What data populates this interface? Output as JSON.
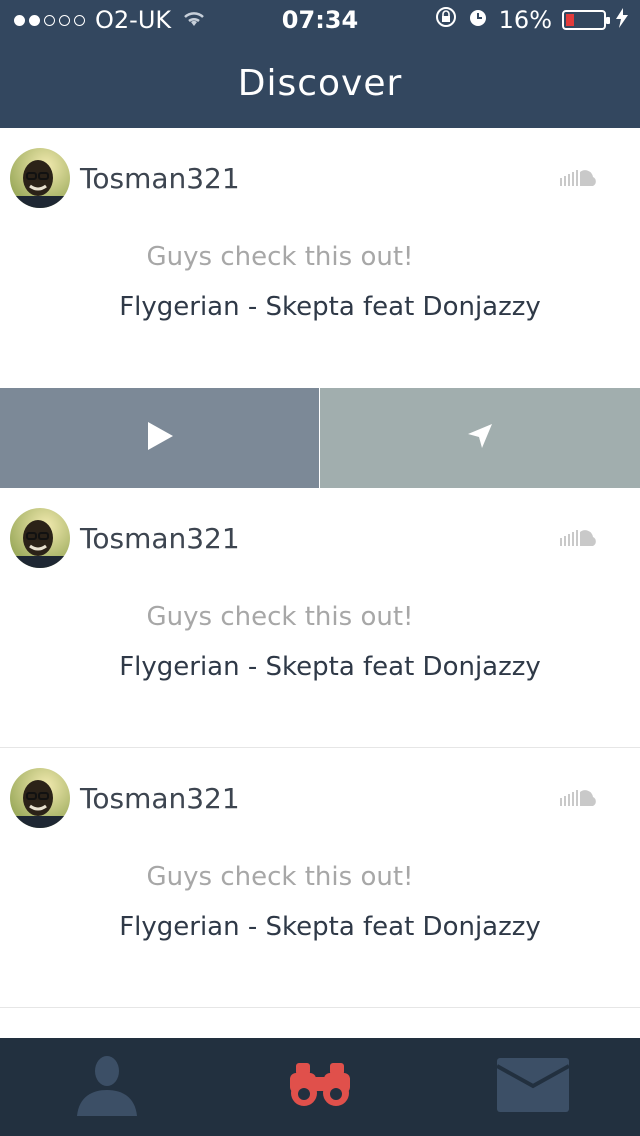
{
  "status": {
    "carrier": "O2-UK",
    "signal_dots_filled": 2,
    "signal_dots_total": 5,
    "time": "07:34",
    "battery_percent": "16%",
    "icons": [
      "wifi-icon",
      "orientation-lock-icon",
      "alarm-icon",
      "battery-icon",
      "charging-icon"
    ]
  },
  "nav": {
    "title": "Discover"
  },
  "feed": {
    "posts": [
      {
        "username": "Tosman321",
        "message": "Guys check this out!",
        "song": "Flygerian - Skepta feat Donjazzy",
        "source_icon": "soundcloud-icon"
      },
      {
        "username": "Tosman321",
        "message": "Guys check this out!",
        "song": "Flygerian - Skepta feat Donjazzy",
        "source_icon": "soundcloud-icon"
      },
      {
        "username": "Tosman321",
        "message": "Guys check this out!",
        "song": "Flygerian - Skepta feat Donjazzy",
        "source_icon": "soundcloud-icon"
      }
    ],
    "actions": {
      "play_icon": "play-icon",
      "locate_icon": "location-arrow-icon"
    }
  },
  "tabs": [
    {
      "icon": "profile-icon",
      "active": false
    },
    {
      "icon": "binoculars-icon",
      "active": true
    },
    {
      "icon": "mail-icon",
      "active": false
    }
  ],
  "colors": {
    "header": "#33475f",
    "tabbar": "#22303f",
    "active_tab": "#e0504b",
    "play_bg": "#7c8997",
    "locate_bg": "#a1aeae"
  }
}
